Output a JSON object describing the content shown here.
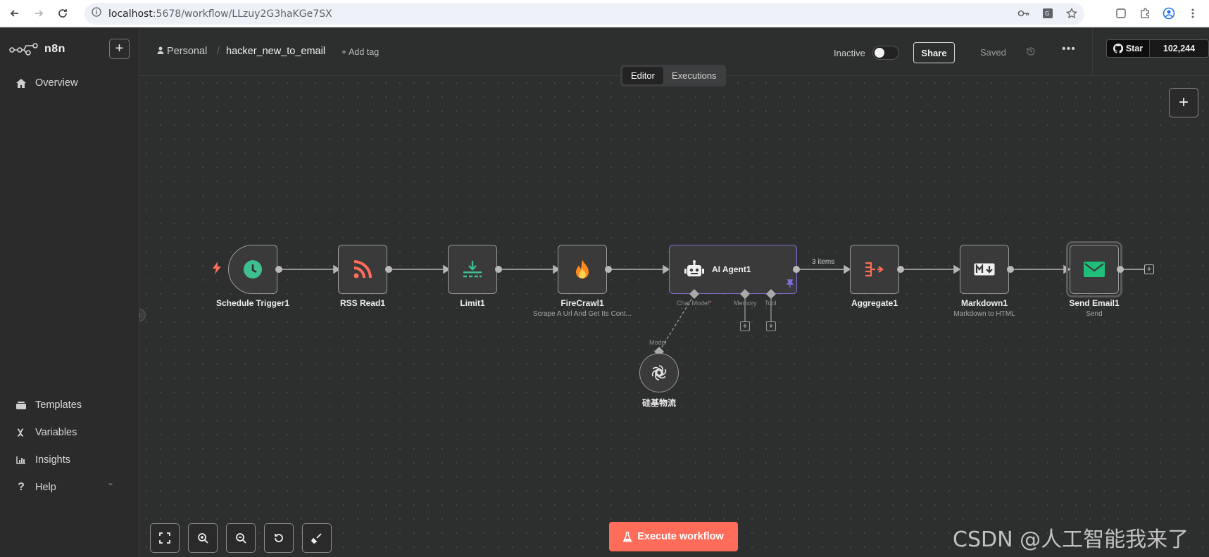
{
  "browser": {
    "url_host": "localhost",
    "url_rest": ":5678/workflow/LLzuy2G3haKGe7SX"
  },
  "sidebar": {
    "brand": "n8n",
    "items": [
      {
        "label": "Overview",
        "icon": "home-icon"
      },
      {
        "label": "Templates",
        "icon": "templates-icon"
      },
      {
        "label": "Variables",
        "icon": "variables-icon"
      },
      {
        "label": "Insights",
        "icon": "insights-icon"
      },
      {
        "label": "Help",
        "icon": "help-icon"
      }
    ]
  },
  "header": {
    "project": "Personal",
    "workflow_name": "hacker_new_to_email",
    "add_tag": "+ Add tag",
    "status": "Inactive",
    "share": "Share",
    "saved": "Saved",
    "github_star": "Star",
    "github_count": "102,244"
  },
  "tabs": [
    "Editor",
    "Executions"
  ],
  "nodes": [
    {
      "label": "Schedule Trigger1",
      "sub": ""
    },
    {
      "label": "RSS Read1",
      "sub": ""
    },
    {
      "label": "Limit1",
      "sub": ""
    },
    {
      "label": "FireCrawl1",
      "sub": "Scrape A Url And Get Its Cont..."
    },
    {
      "label": "AI Agent1",
      "sub": ""
    },
    {
      "label": "Aggregate1",
      "sub": ""
    },
    {
      "label": "Markdown1",
      "sub": "Markdown to HTML"
    },
    {
      "label": "Send Email1",
      "sub": "Send"
    },
    {
      "label": "硅基物流",
      "sub": ""
    }
  ],
  "agent_ports": {
    "chat_model": "Chat Model",
    "required_mark": "*",
    "memory": "Memory",
    "tool": "Tool",
    "model": "Model"
  },
  "connection_label": "3 items",
  "execute_button": "Execute workflow",
  "watermark": "CSDN @人工智能我来了",
  "colors": {
    "accent": "#ff6d5a",
    "trigger_green": "#3fbf8f",
    "agent_border": "#7e6fd8",
    "email_green": "#1fbf7a"
  }
}
